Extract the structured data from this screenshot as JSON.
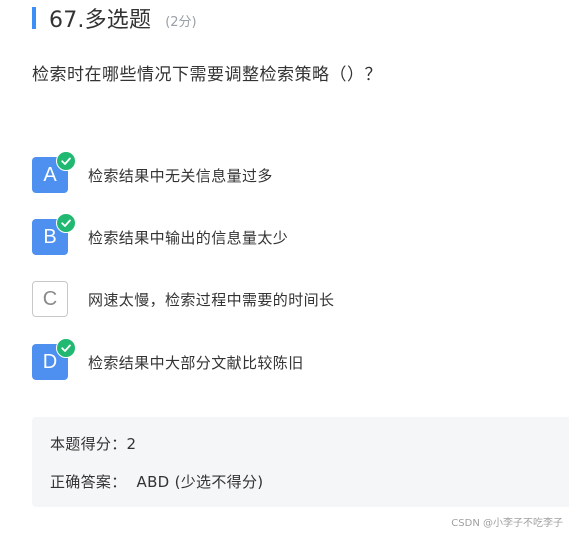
{
  "header": {
    "number_title": "67.多选题",
    "score_note": "(2分)"
  },
  "question": {
    "text": "检索时在哪些情况下需要调整检索策略（）？"
  },
  "options": [
    {
      "letter": "A",
      "text": "检索结果中无关信息量过多",
      "selected": true
    },
    {
      "letter": "B",
      "text": "检索结果中输出的信息量太少",
      "selected": true
    },
    {
      "letter": "C",
      "text": "网速太慢，检索过程中需要的时间长",
      "selected": false
    },
    {
      "letter": "D",
      "text": "检索结果中大部分文献比较陈旧",
      "selected": true
    }
  ],
  "result": {
    "score_label": "本题得分：",
    "score_value": "2",
    "answer_label": "正确答案：",
    "answer_value": "ABD (少选不得分)"
  },
  "watermark": "CSDN @小李子不吃李子",
  "colors": {
    "accent": "#3e8ef7",
    "selected_option": "#4d90f0",
    "check_badge": "#21b871",
    "panel_bg": "#f5f6f7"
  }
}
